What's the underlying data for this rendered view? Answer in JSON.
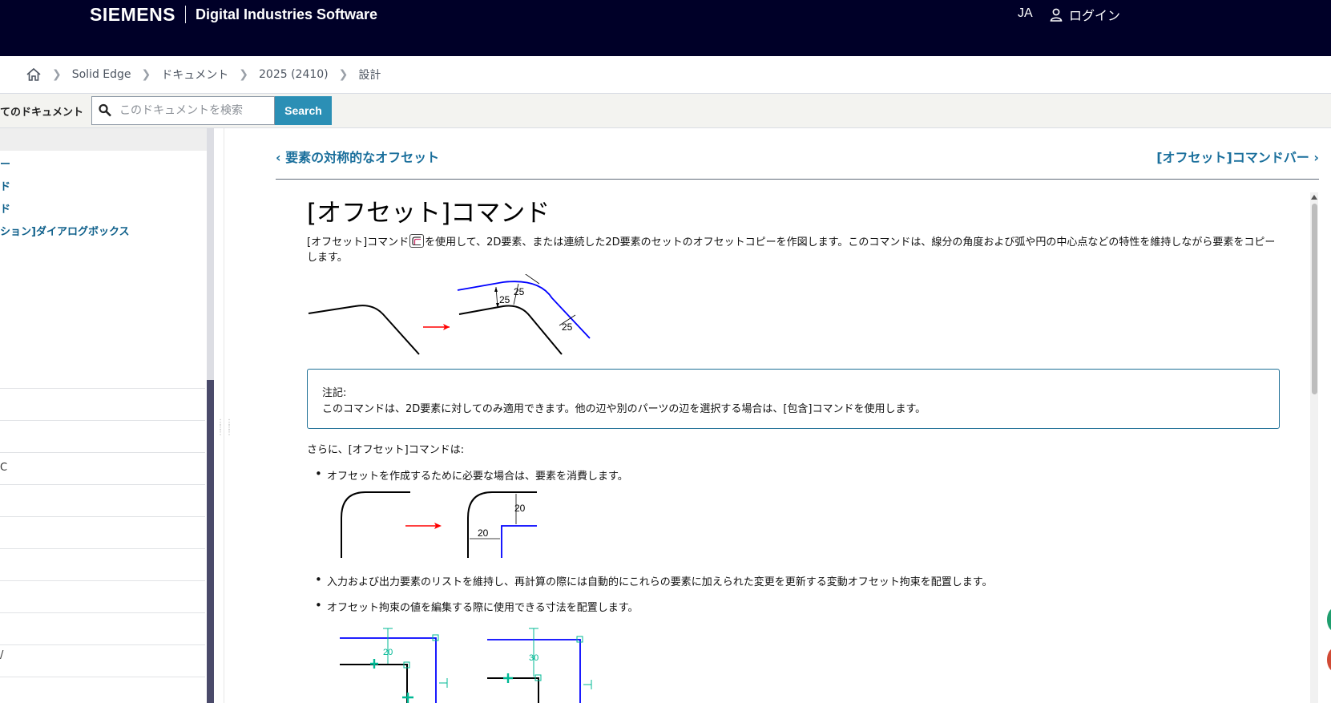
{
  "header": {
    "brand": "SIEMENS",
    "subtitle": "Digital Industries Software",
    "language": "JA",
    "login_label": "ログイン"
  },
  "breadcrumb": {
    "items": [
      "Solid Edge",
      "ドキュメント",
      "2025 (2410)",
      "設計"
    ]
  },
  "search": {
    "scope_label": "てのドキュメント",
    "placeholder": "このドキュメントを検索",
    "button_label": "Search"
  },
  "sidebar": {
    "items": [
      "ー",
      "ド",
      "ド",
      "ション]ダイアログボックス"
    ],
    "fragments": [
      "C",
      "/"
    ]
  },
  "nav": {
    "prev_label": "要素の対称的なオフセット",
    "next_label": "[オフセット]コマンドバー"
  },
  "article": {
    "title": "[オフセット]コマンド",
    "intro_before_icon": "[オフセット]コマンド",
    "intro_after_icon": "を使用して、2D要素、または連続した2D要素のセットのオフセットコピーを作図します。このコマンドは、線分の角度および弧や円の中心点などの特性を維持しながら要素をコピーします。",
    "note_label": "注記:",
    "note_text": "このコマンドは、2D要素に対してのみ適用できます。他の辺や別のパーツの辺を選択する場合は、[包含]コマンドを使用します。",
    "para": "さらに、[オフセット]コマンドは:",
    "bullets": [
      "オフセットを作成するために必要な場合は、要素を消費します。",
      "入力および出力要素のリストを維持し、再計算の際には自動的にこれらの要素に加えられた変更を更新する変動オフセット拘束を配置します。",
      "オフセット拘束の値を編集する際に使用できる寸法を配置します。"
    ],
    "fig1_dims": [
      "25",
      "25",
      "25"
    ],
    "fig2_dims": [
      "20",
      "20"
    ],
    "fig3_dims": [
      "20",
      "30"
    ]
  },
  "colors": {
    "header_bg": "#000028",
    "link": "#1a6f9c",
    "search_button": "#2b8fb5",
    "offset_blue": "#0000ff",
    "arrow_red": "#ff0000",
    "dim_teal": "#00b894"
  }
}
